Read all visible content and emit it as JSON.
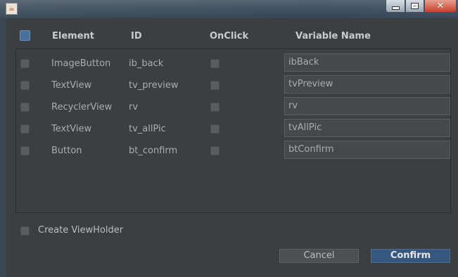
{
  "window": {
    "title": "",
    "app_icon": "java-icon"
  },
  "header": {
    "col_element": "Element",
    "col_id": "ID",
    "col_onclick": "OnClick",
    "col_variable": "Variable Name"
  },
  "rows": [
    {
      "element": "ImageButton",
      "id": "ib_back",
      "variable": "ibBack"
    },
    {
      "element": "TextView",
      "id": "tv_preview",
      "variable": "tvPreview"
    },
    {
      "element": "RecyclerView",
      "id": "rv",
      "variable": "rv"
    },
    {
      "element": "TextView",
      "id": "tv_allPic",
      "variable": "tvAllPic"
    },
    {
      "element": "Button",
      "id": "bt_confirm",
      "variable": "btConfirm"
    }
  ],
  "footer": {
    "viewholder_label": "Create ViewHolder",
    "cancel_label": "Cancel",
    "confirm_label": "Confirm"
  },
  "colors": {
    "dialog_bg": "#3c3f41",
    "confirm_bg": "#365880",
    "text": "#a9adb1"
  }
}
